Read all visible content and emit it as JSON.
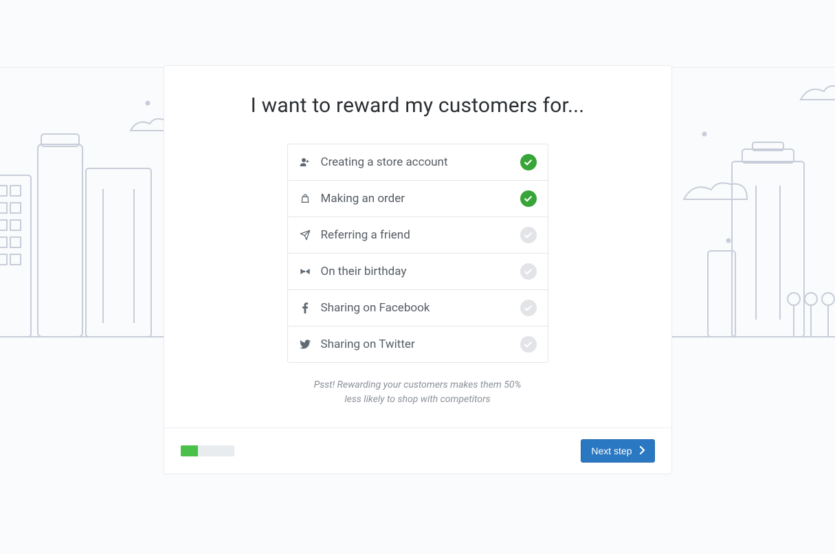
{
  "header": {
    "title": "I want to reward my customers for..."
  },
  "options": [
    {
      "icon": "user-plus-icon",
      "label": "Creating a store account",
      "selected": true
    },
    {
      "icon": "bag-icon",
      "label": "Making an order",
      "selected": true
    },
    {
      "icon": "send-icon",
      "label": "Referring a friend",
      "selected": false
    },
    {
      "icon": "bowtie-icon",
      "label": "On their birthday",
      "selected": false
    },
    {
      "icon": "facebook-icon",
      "label": "Sharing on Facebook",
      "selected": false
    },
    {
      "icon": "twitter-icon",
      "label": "Sharing on Twitter",
      "selected": false
    }
  ],
  "hint": "Psst! Rewarding your customers makes them 50% less likely to shop with competitors",
  "footer": {
    "progress_pct": 33,
    "next_label": "Next step"
  },
  "colors": {
    "accent_green": "#38a538",
    "primary_blue": "#2b78c2"
  }
}
